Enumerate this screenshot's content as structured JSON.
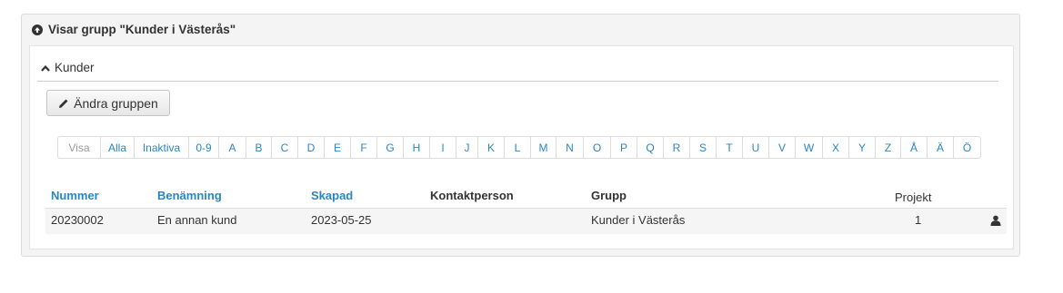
{
  "panel": {
    "title": "Visar grupp \"Kunder i Västerås\""
  },
  "section": {
    "title": "Kunder"
  },
  "toolbar": {
    "edit_label": "Ändra gruppen"
  },
  "filter": {
    "items": [
      "Visa",
      "Alla",
      "Inaktiva",
      "0-9",
      "A",
      "B",
      "C",
      "D",
      "E",
      "F",
      "G",
      "H",
      "I",
      "J",
      "K",
      "L",
      "M",
      "N",
      "O",
      "P",
      "Q",
      "R",
      "S",
      "T",
      "U",
      "V",
      "W",
      "X",
      "Y",
      "Z",
      "Å",
      "Ä",
      "Ö"
    ]
  },
  "table": {
    "headers": {
      "nummer": "Nummer",
      "benamning": "Benämning",
      "skapad": "Skapad",
      "kontaktperson": "Kontaktperson",
      "grupp": "Grupp",
      "projekt": "Projekt"
    },
    "rows": [
      {
        "nummer": "20230002",
        "benamning": "En annan kund",
        "skapad": "2023-05-25",
        "kontaktperson": "",
        "grupp": "Kunder i Västerås",
        "projekt": "1",
        "action_icon": "user-icon"
      }
    ]
  },
  "colors": {
    "link": "#2a86c2",
    "text": "#333333"
  }
}
